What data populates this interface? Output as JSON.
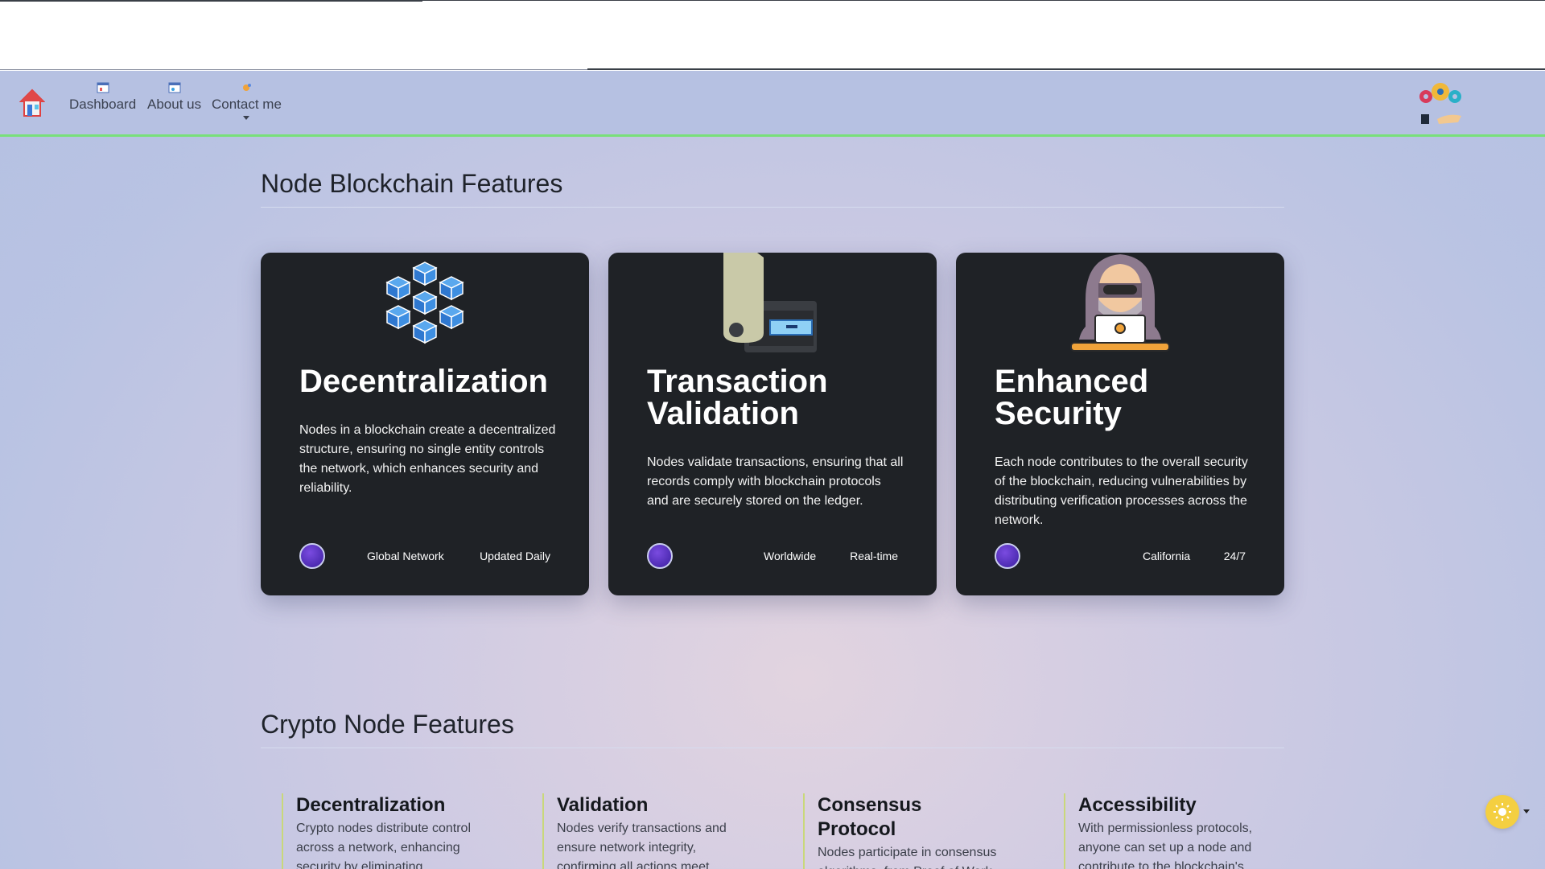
{
  "nav": {
    "items": [
      {
        "label": "Dashboard"
      },
      {
        "label": "About us"
      },
      {
        "label": "Contact me"
      }
    ]
  },
  "sections": {
    "blockchain_title": "Node Blockchain Features",
    "crypto_title": "Crypto Node Features"
  },
  "cards": [
    {
      "title": "Decentralization",
      "description": "Nodes in a blockchain create a decentralized structure, ensuring no single entity controls the network, which enhances security and reliability.",
      "footer_left": "Global Network",
      "footer_right": "Updated Daily"
    },
    {
      "title": "Transaction Validation",
      "description": "Nodes validate transactions, ensuring that all records comply with blockchain protocols and are securely stored on the ledger.",
      "footer_left": "Worldwide",
      "footer_right": "Real-time"
    },
    {
      "title": "Enhanced Security",
      "description": "Each node contributes to the overall security of the blockchain, reducing vulnerabilities by distributing verification processes across the network.",
      "footer_left": "California",
      "footer_right": "24/7"
    }
  ],
  "features": [
    {
      "title": "Decentralization",
      "text": "Crypto nodes distribute control across a network, enhancing security by eliminating centralized"
    },
    {
      "title": "Validation",
      "text": "Nodes verify transactions and ensure network integrity, confirming all actions meet protocol standards."
    },
    {
      "title": "Consensus Protocol",
      "text": "Nodes participate in consensus algorithms, from Proof of Work to Proof of Stake, to secure"
    },
    {
      "title": "Accessibility",
      "text": "With permissionless protocols, anyone can set up a node and contribute to the blockchain's"
    }
  ],
  "colors": {
    "card_bg": "#1f2226",
    "nav_bg": "#b6c1e2",
    "nav_border": "#78e07a",
    "toggle": "#f4cf41"
  }
}
